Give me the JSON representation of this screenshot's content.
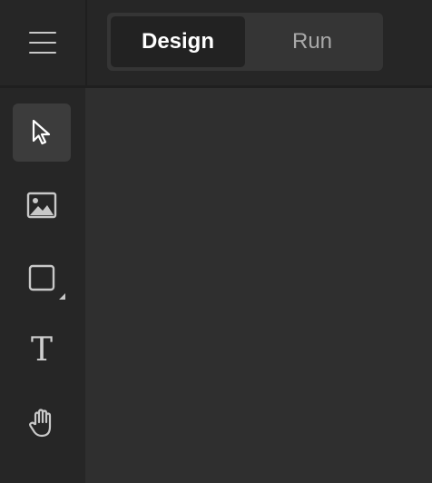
{
  "header": {
    "menu_icon": "hamburger-menu-icon",
    "mode_tabs": [
      {
        "label": "Design",
        "active": true
      },
      {
        "label": "Run",
        "active": false
      }
    ]
  },
  "toolbar": {
    "tools": [
      {
        "name": "select",
        "icon": "pointer-arrow-icon",
        "active": true
      },
      {
        "name": "image",
        "icon": "image-icon",
        "active": false
      },
      {
        "name": "shape",
        "icon": "square-icon",
        "active": false
      },
      {
        "name": "text",
        "icon": "text-icon",
        "glyph": "T",
        "active": false
      },
      {
        "name": "pan",
        "icon": "hand-icon",
        "active": false
      }
    ]
  },
  "colors": {
    "panel": "#262626",
    "canvas": "#2f2f2f",
    "active_tab_bg": "#222222",
    "active_tool_bg": "#3c3c3c",
    "icon": "#c8c8c8"
  }
}
